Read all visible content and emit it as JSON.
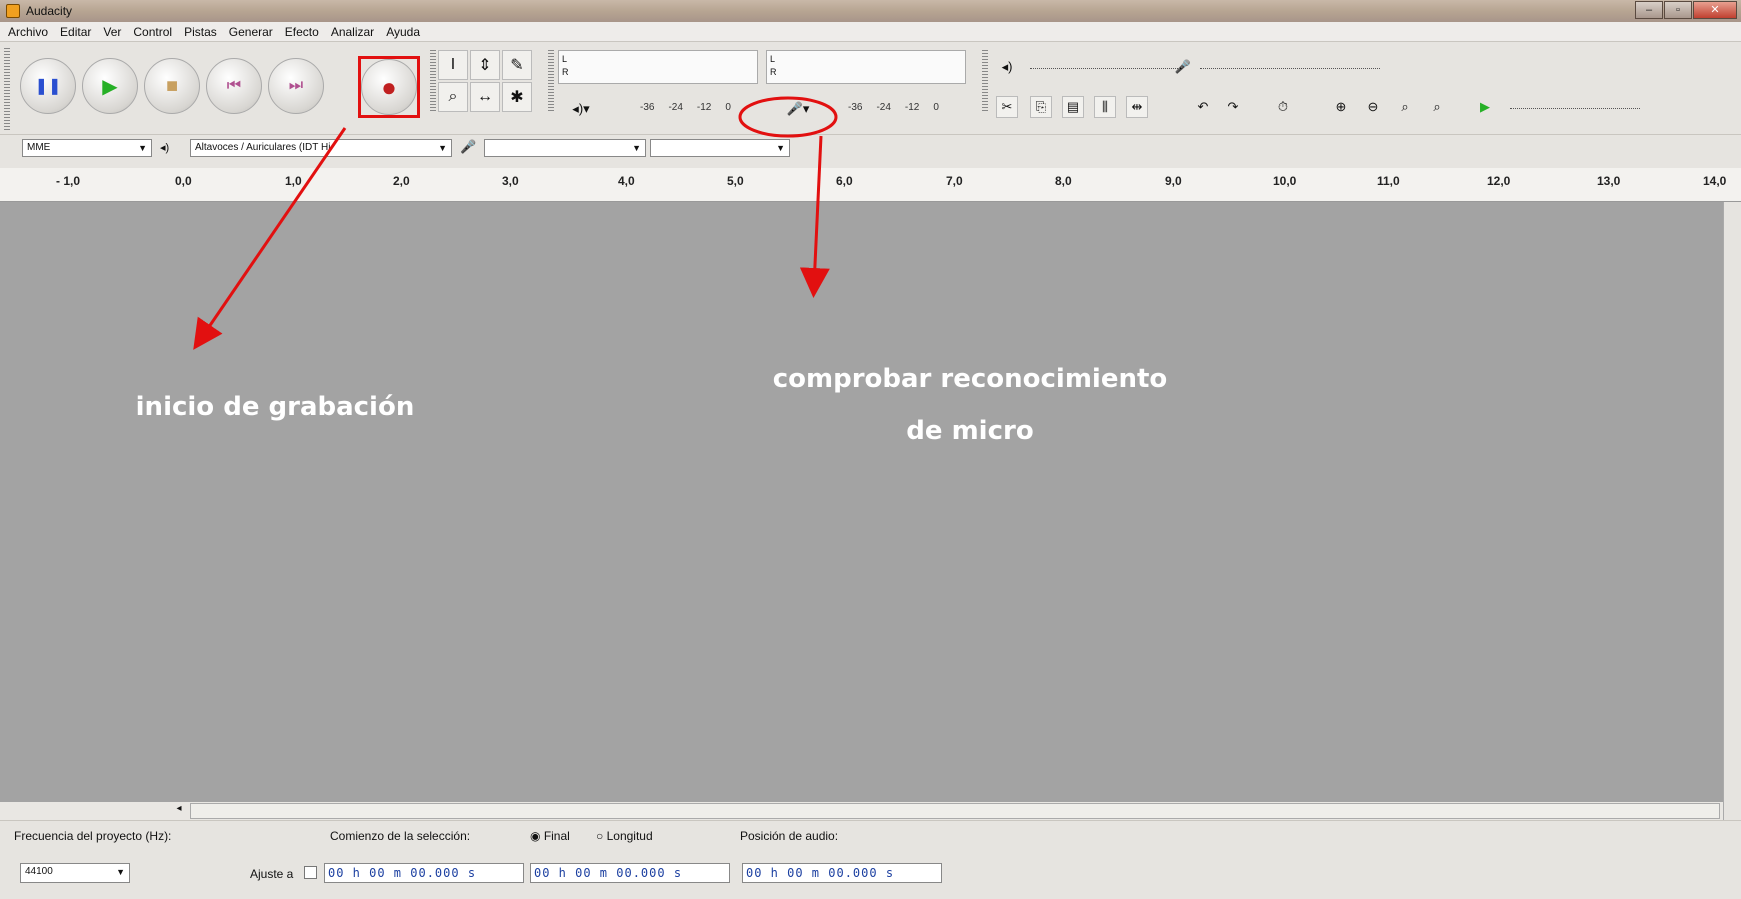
{
  "window": {
    "title": "Audacity",
    "buttons": [
      "–",
      "▫",
      "✕"
    ]
  },
  "menu": [
    "Archivo",
    "Editar",
    "Ver",
    "Control",
    "Pistas",
    "Generar",
    "Efecto",
    "Analizar",
    "Ayuda"
  ],
  "transport": [
    {
      "name": "pause-button",
      "icon": "pause-icon",
      "glyph": "❚❚",
      "color": "#2a4fd0"
    },
    {
      "name": "play-button",
      "icon": "play-icon",
      "glyph": "▶",
      "color": "#26b026"
    },
    {
      "name": "stop-button",
      "icon": "stop-icon",
      "glyph": "■",
      "color": "#c8a060"
    },
    {
      "name": "skip-start-button",
      "icon": "skip-start-icon",
      "glyph": "⏮",
      "color": "#b05090"
    },
    {
      "name": "skip-end-button",
      "icon": "skip-end-icon",
      "glyph": "⏭",
      "color": "#b05090"
    },
    {
      "name": "record-button",
      "icon": "record-icon",
      "glyph": "●",
      "color": "#c02020"
    }
  ],
  "tools": [
    "I",
    "⇕",
    "✎",
    "⌕",
    "↔",
    "✱"
  ],
  "meters": {
    "playback": {
      "l": "L",
      "r": "R",
      "scale": [
        "-36",
        "-24",
        "-12",
        "0"
      ]
    },
    "record": {
      "l": "L",
      "r": "R",
      "scale": [
        "-36",
        "-24",
        "-12",
        "0"
      ]
    }
  },
  "devices": {
    "host": "MME",
    "output": "Altavoces / Auriculares (IDT Hi",
    "input": "",
    "channels": ""
  },
  "ruler": [
    "- 1,0",
    "0,0",
    "1,0",
    "2,0",
    "3,0",
    "4,0",
    "5,0",
    "6,0",
    "7,0",
    "8,0",
    "9,0",
    "10,0",
    "11,0",
    "12,0",
    "13,0",
    "14,0"
  ],
  "status": {
    "rate_label": "Frecuencia del proyecto (Hz):",
    "rate_value": "44100",
    "sel_start_label": "Comienzo de la selección:",
    "final_label": "Final",
    "length_label": "Longitud",
    "snap_label": "Ajuste a",
    "time_start": "00 h 00 m 00.000 s",
    "time_end": "00 h 00 m 00.000 s",
    "audio_pos_label": "Posición de audio:",
    "audio_pos": "00 h 00 m 00.000 s"
  },
  "annotations": {
    "record_note": "inicio de grabación",
    "mic_note_line1": "comprobar reconocimiento",
    "mic_note_line2": "de micro"
  },
  "colors": {
    "annotation_red": "#e21010",
    "track_bg": "#a3a3a3"
  }
}
